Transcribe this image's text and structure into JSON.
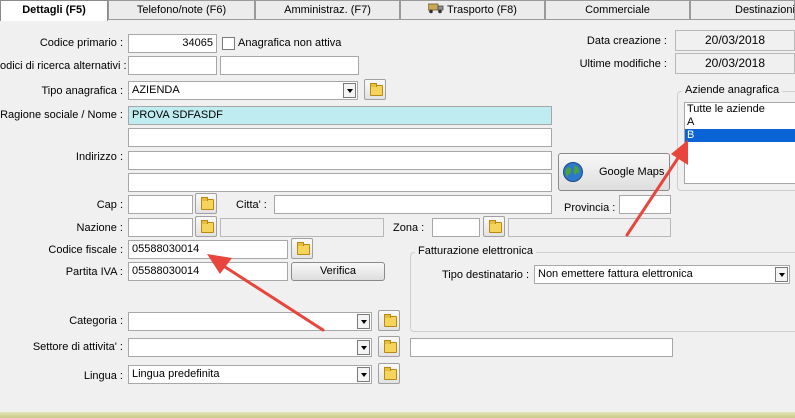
{
  "tabs": [
    {
      "label": "Dettagli (F5)"
    },
    {
      "label": "Telefono/note (F6)"
    },
    {
      "label": "Amministraz. (F7)"
    },
    {
      "label": "Trasporto (F8)"
    },
    {
      "label": "Commerciale"
    },
    {
      "label": "Destinazioni"
    }
  ],
  "form": {
    "codice_primario_label": "Codice primario :",
    "codice_primario_value": "34065",
    "anagrafica_non_attiva_label": "Anagrafica non attiva",
    "codici_alternativi_label": "odici di ricerca alternativi :",
    "tipo_anagrafica_label": "Tipo anagrafica :",
    "tipo_anagrafica_value": "AZIENDA",
    "ragione_sociale_label": "Ragione sociale / Nome :",
    "ragione_sociale_value": "PROVA SDFASDF",
    "indirizzo_label": "Indirizzo :",
    "google_maps_label": "Google Maps",
    "cap_label": "Cap :",
    "citta_label": "Citta' :",
    "provincia_label": "Provincia :",
    "nazione_label": "Nazione :",
    "zona_label": "Zona :",
    "codice_fiscale_label": "Codice fiscale :",
    "codice_fiscale_value": "05588030014",
    "partita_iva_label": "Partita IVA :",
    "partita_iva_value": "05588030014",
    "verifica_label": "Verifica",
    "categoria_label": "Categoria :",
    "settore_label": "Settore di attivita' :",
    "lingua_label": "Lingua :",
    "lingua_value": "Lingua predefinita"
  },
  "dates": {
    "creazione_label": "Data creazione :",
    "creazione_value": "20/03/2018",
    "modifiche_label": "Ultime modifiche :",
    "modifiche_value": "20/03/2018"
  },
  "aziende": {
    "title": "Aziende anagrafica",
    "items": [
      {
        "label": "Tutte le aziende",
        "selected": false
      },
      {
        "label": "A",
        "selected": false
      },
      {
        "label": "B",
        "selected": true
      }
    ]
  },
  "fatturazione": {
    "title": "Fatturazione elettronica",
    "tipo_label": "Tipo destinatario :",
    "tipo_value": "Non emettere fattura elettronica"
  },
  "annotation_color": "#e8453c",
  "icons": {
    "folder": "folder-icon",
    "globe": "globe-icon",
    "truck": "truck-icon",
    "dropdown": "chevron-down-icon"
  }
}
